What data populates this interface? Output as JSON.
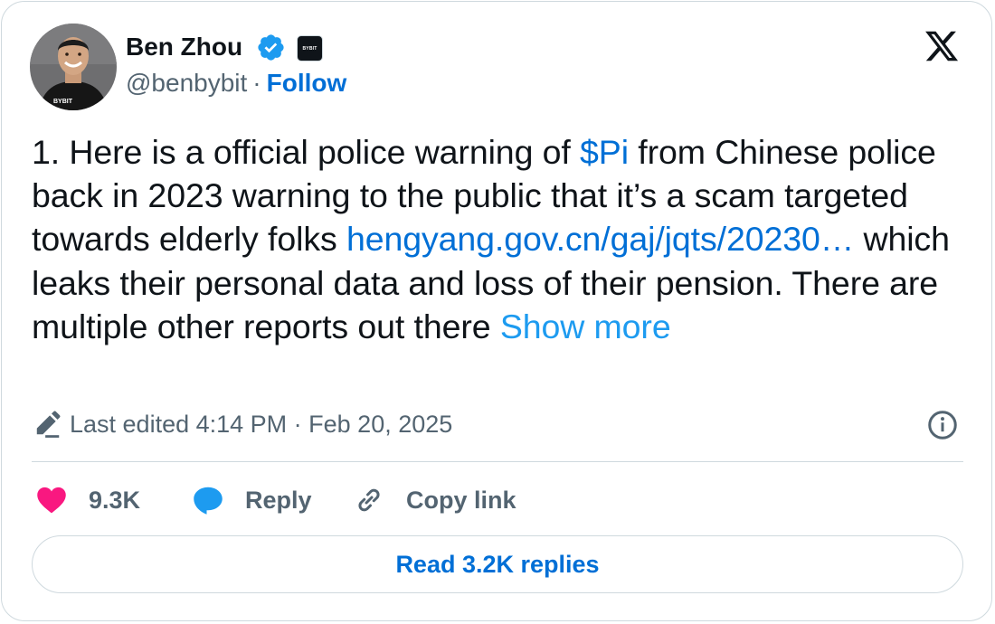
{
  "author": {
    "name": "Ben Zhou",
    "handle": "@benbybit",
    "separator": "·",
    "follow_label": "Follow",
    "avatar_shirt_text": "BYBIT",
    "affiliate_badge_text": "BYBIT"
  },
  "tweet": {
    "line1_prefix": "1. Here is a official police warning of ",
    "cashtag": "$Pi",
    "line1_suffix": " from Chinese police back in 2023 warning to the public that it’s a scam targeted towards elderly folks ",
    "link_text": "hengyang.gov.cn/gaj/jqts/20230…",
    "continuation": " which leaks their personal data and loss of their pension. There are multiple other reports out there ",
    "show_more": "Show more"
  },
  "meta": {
    "edited_text": "Last edited 4:14 PM · Feb 20, 2025"
  },
  "actions": {
    "like_count": "9.3K",
    "reply_label": "Reply",
    "copy_link_label": "Copy link"
  },
  "read_replies_label": "Read 3.2K replies",
  "icons": {
    "verified": "verified-badge-icon",
    "x_logo": "x-logo-icon",
    "pencil": "pencil-icon",
    "info": "info-icon",
    "heart": "heart-icon",
    "reply": "reply-bubble-icon",
    "link": "link-icon"
  },
  "colors": {
    "link_blue": "#006fd6",
    "show_more_blue": "#1d9bf0",
    "heart_red": "#f91880",
    "verified_blue": "#1d9bf0",
    "text_primary": "#0f1419",
    "text_secondary": "#536471",
    "border": "#cfd9de"
  }
}
